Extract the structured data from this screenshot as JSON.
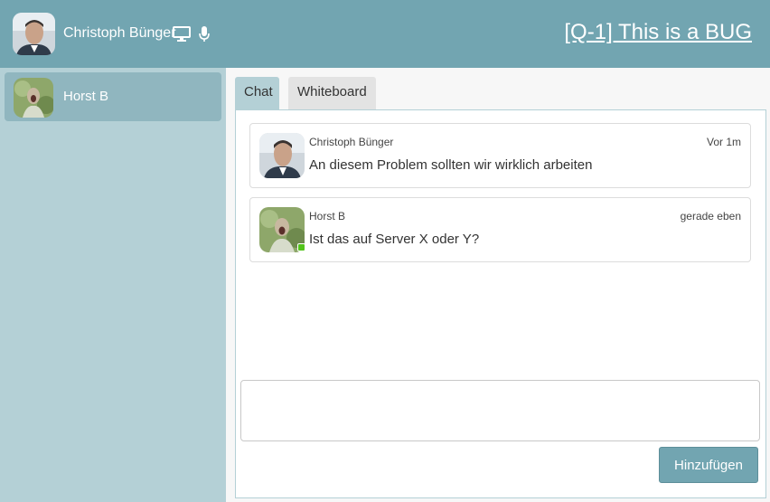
{
  "header": {
    "user_name": "Christoph Bünger",
    "issue_title": "[Q-1] This is a BUG",
    "icons": [
      "monitor-icon",
      "microphone-icon"
    ]
  },
  "sidebar": {
    "participants": [
      {
        "name": "Horst B",
        "active": true
      }
    ]
  },
  "tabs": [
    {
      "label": "Chat",
      "active": true
    },
    {
      "label": "Whiteboard",
      "active": false
    }
  ],
  "messages": [
    {
      "author": "Christoph Bünger",
      "time": "Vor 1m",
      "text": "An diesem Problem sollten wir wirklich arbeiten",
      "online": false
    },
    {
      "author": "Horst B",
      "time": "gerade eben",
      "text": "Ist das auf Server X oder Y?",
      "online": true
    }
  ],
  "composer": {
    "value": "",
    "submit_label": "Hinzufügen"
  },
  "colors": {
    "header": "#72a5b1",
    "sidebar": "#b4d0d6",
    "sidebar_active": "#90b6bf",
    "online": "#52c41a"
  }
}
